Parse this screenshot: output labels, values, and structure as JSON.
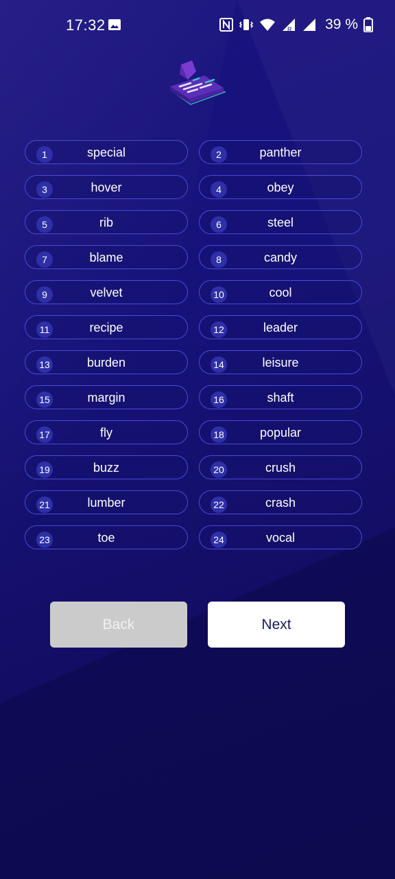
{
  "status_bar": {
    "time": "17:32",
    "battery": "39 %",
    "icons": [
      "gallery-icon",
      "nfc-icon",
      "vibrate-icon",
      "wifi-icon",
      "signal-r-icon",
      "signal-icon",
      "battery-icon"
    ]
  },
  "words": [
    {
      "n": "1",
      "w": "special"
    },
    {
      "n": "2",
      "w": "panther"
    },
    {
      "n": "3",
      "w": "hover"
    },
    {
      "n": "4",
      "w": "obey"
    },
    {
      "n": "5",
      "w": "rib"
    },
    {
      "n": "6",
      "w": "steel"
    },
    {
      "n": "7",
      "w": "blame"
    },
    {
      "n": "8",
      "w": "candy"
    },
    {
      "n": "9",
      "w": "velvet"
    },
    {
      "n": "10",
      "w": "cool"
    },
    {
      "n": "11",
      "w": "recipe"
    },
    {
      "n": "12",
      "w": "leader"
    },
    {
      "n": "13",
      "w": "burden"
    },
    {
      "n": "14",
      "w": "leisure"
    },
    {
      "n": "15",
      "w": "margin"
    },
    {
      "n": "16",
      "w": "shaft"
    },
    {
      "n": "17",
      "w": "fly"
    },
    {
      "n": "18",
      "w": "popular"
    },
    {
      "n": "19",
      "w": "buzz"
    },
    {
      "n": "20",
      "w": "crush"
    },
    {
      "n": "21",
      "w": "lumber"
    },
    {
      "n": "22",
      "w": "crash"
    },
    {
      "n": "23",
      "w": "toe"
    },
    {
      "n": "24",
      "w": "vocal"
    }
  ],
  "buttons": {
    "back": "Back",
    "next": "Next"
  },
  "colors": {
    "background": "#17127a",
    "chip_border": "#4a4ad8",
    "number_badge": "#2f2fa8",
    "back_button": "#cbcbcb",
    "next_button": "#ffffff",
    "next_text": "#1b1a5c"
  }
}
